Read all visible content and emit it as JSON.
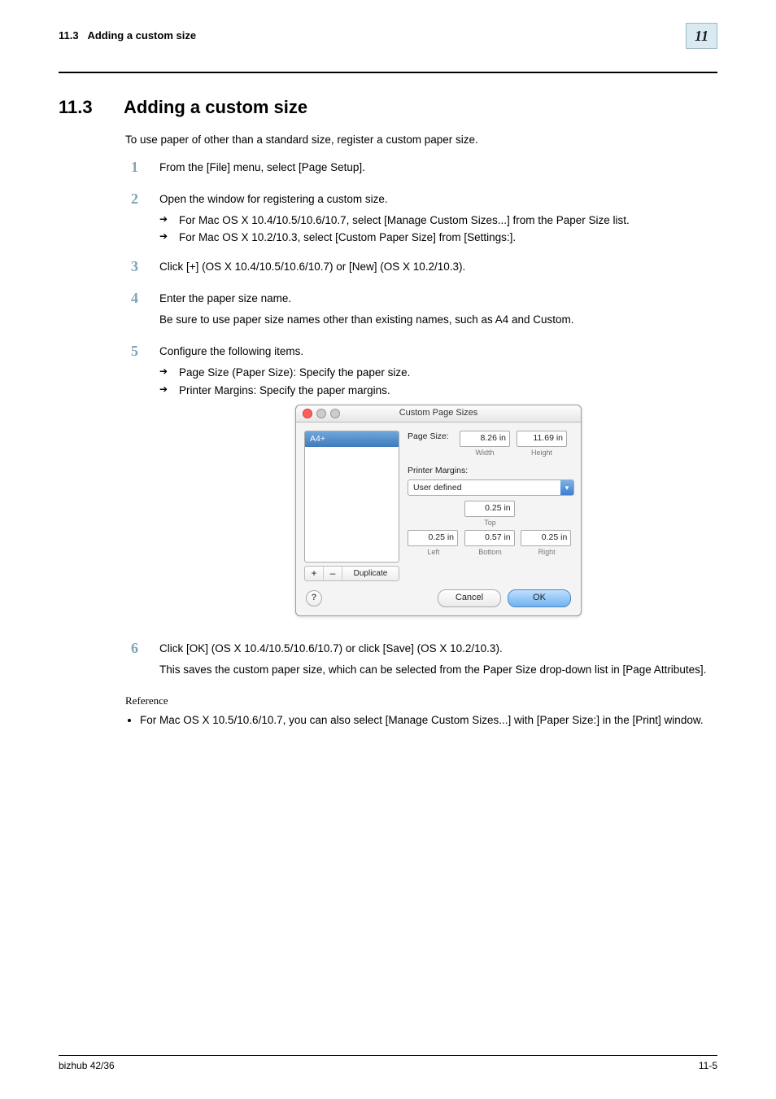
{
  "header": {
    "section_ref": "11.3",
    "section_name": "Adding a custom size",
    "chapter_num": "11"
  },
  "title": {
    "num": "11.3",
    "text": "Adding a custom size"
  },
  "intro": "To use paper of other than a standard size, register a custom paper size.",
  "steps": [
    {
      "n": "1",
      "paras": [
        "From the [File] menu, select [Page Setup]."
      ]
    },
    {
      "n": "2",
      "paras": [
        "Open the window for registering a custom size."
      ],
      "arrows": [
        "For Mac OS X 10.4/10.5/10.6/10.7, select [Manage Custom Sizes...] from the Paper Size list.",
        "For Mac OS X 10.2/10.3, select [Custom Paper Size] from [Settings:]."
      ]
    },
    {
      "n": "3",
      "paras": [
        "Click [+] (OS X 10.4/10.5/10.6/10.7) or [New] (OS X 10.2/10.3)."
      ]
    },
    {
      "n": "4",
      "paras": [
        "Enter the paper size name.",
        "Be sure to use paper size names other than existing names, such as A4 and Custom."
      ]
    },
    {
      "n": "5",
      "paras": [
        "Configure the following items."
      ],
      "arrows": [
        "Page Size (Paper Size): Specify the paper size.",
        "Printer Margins: Specify the paper margins."
      ]
    },
    {
      "n": "6",
      "paras": [
        "Click [OK] (OS X 10.4/10.5/10.6/10.7) or click [Save] (OS X 10.2/10.3).",
        "This saves the custom paper size, which can be selected from the Paper Size drop-down list in [Page Attributes]."
      ]
    }
  ],
  "reference": {
    "heading": "Reference",
    "bullets": [
      "For Mac OS X 10.5/10.6/10.7, you can also select [Manage Custom Sizes...] with [Paper Size:] in the [Print] window."
    ]
  },
  "dialog": {
    "title": "Custom Page Sizes",
    "list_item": "A4+",
    "toolbar": {
      "plus": "+",
      "minus": "–",
      "duplicate": "Duplicate"
    },
    "page_size_label": "Page Size:",
    "width_value": "8.26 in",
    "width_label": "Width",
    "height_value": "11.69 in",
    "height_label": "Height",
    "printer_margins_label": "Printer Margins:",
    "margins_select": "User defined",
    "top_value": "0.25 in",
    "top_label": "Top",
    "left_value": "0.25 in",
    "left_label": "Left",
    "right_value": "0.25 in",
    "right_label": "Right",
    "bottom_value": "0.57 in",
    "bottom_label": "Bottom",
    "help": "?",
    "cancel": "Cancel",
    "ok": "OK"
  },
  "footer": {
    "left": "bizhub 42/36",
    "right": "11-5"
  }
}
